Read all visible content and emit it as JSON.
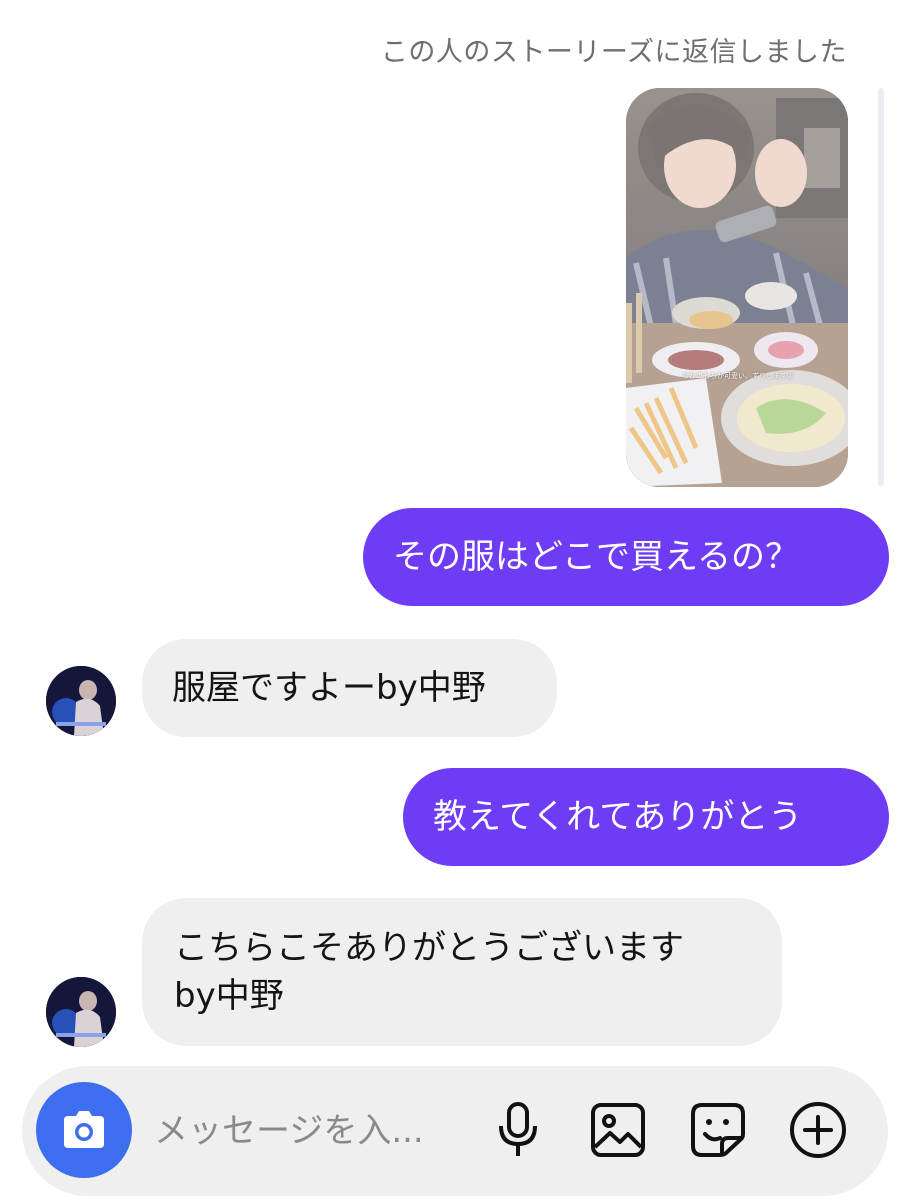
{
  "conversation": {
    "story_reply_caption": "この人のストーリーズに返信しました",
    "story": {
      "overlay_text": "なかのもちか可愛い、ずりしますよ"
    },
    "messages": [
      {
        "direction": "out",
        "text": "その服はどこで買えるの？"
      },
      {
        "direction": "in",
        "text": "服屋ですよーby中野"
      },
      {
        "direction": "out",
        "text": "教えてくれてありがとう"
      },
      {
        "direction": "in",
        "text": "こちらこそありがとうございます\nby中野"
      }
    ]
  },
  "composer": {
    "placeholder": "メッセージを入...",
    "icons": [
      "camera-icon",
      "microphone-icon",
      "image-icon",
      "sticker-icon",
      "plus-icon"
    ],
    "camera_color": "#3e6ef0"
  },
  "theme": {
    "outgoing_bubble": "#6e3cf5",
    "incoming_bubble": "#efeff0"
  }
}
